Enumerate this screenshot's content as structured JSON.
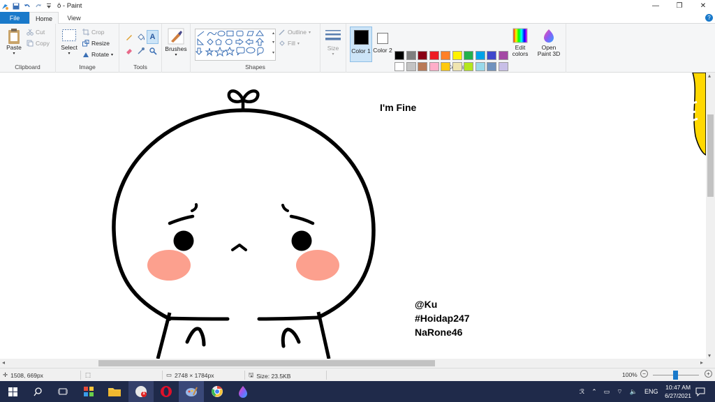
{
  "window": {
    "title": "ô - Paint",
    "minimize_glyph": "—",
    "maximize_glyph": "❐",
    "close_glyph": "✕"
  },
  "menu": {
    "file": "File",
    "home": "Home",
    "view": "View",
    "help_glyph": "?"
  },
  "ribbon": {
    "clipboard": {
      "label": "Clipboard",
      "paste": "Paste",
      "cut": "Cut",
      "copy": "Copy"
    },
    "image": {
      "label": "Image",
      "select": "Select",
      "crop": "Crop",
      "resize": "Resize",
      "rotate": "Rotate"
    },
    "tools": {
      "label": "Tools"
    },
    "brushes": {
      "label": "Brushes"
    },
    "shapes": {
      "label": "Shapes",
      "outline": "Outline",
      "fill": "Fill"
    },
    "size": {
      "label": "Size"
    },
    "colors": {
      "label": "Colors",
      "color1": "Color 1",
      "color2": "Color 2",
      "edit_colors": "Edit colors",
      "open_paint3d": "Open Paint 3D",
      "color1_value": "#000000",
      "color2_value": "#ffffff",
      "palette": [
        [
          "#000000",
          "#7f7f7f",
          "#880015",
          "#ed1c24",
          "#ff7f27",
          "#fff200",
          "#22b14c",
          "#00a2e8",
          "#3f48cc",
          "#a349a4"
        ],
        [
          "#ffffff",
          "#c3c3c3",
          "#b97a57",
          "#ffaec9",
          "#ffc90e",
          "#efe4b0",
          "#b5e61d",
          "#99d9ea",
          "#7092be",
          "#c8bfe7"
        ],
        [
          "#f88a88",
          "#f7a68c",
          "#d8f08c",
          "#6cd86c",
          "#7ad87a",
          "#f8e07a",
          "#ffffff",
          "#ffffff",
          "#ffffff",
          "#ffffff"
        ]
      ]
    }
  },
  "canvas": {
    "text1": "I'm Fine",
    "text2": "@Ku",
    "text3": "#Hoidap247",
    "text4": "NaRone46",
    "cheek_color": "#fca08e",
    "sticker_color": "#ffd800"
  },
  "status": {
    "cursor_pos": "1508, 669px",
    "image_dims": "2748 × 1784px",
    "file_size": "Size: 23.5KB",
    "zoom": "100%"
  },
  "taskbar": {
    "lang": "ENG",
    "time": "10:47 AM",
    "date": "6/27/2021",
    "notif_count": "1",
    "tray_up_glyph": "⌃"
  }
}
